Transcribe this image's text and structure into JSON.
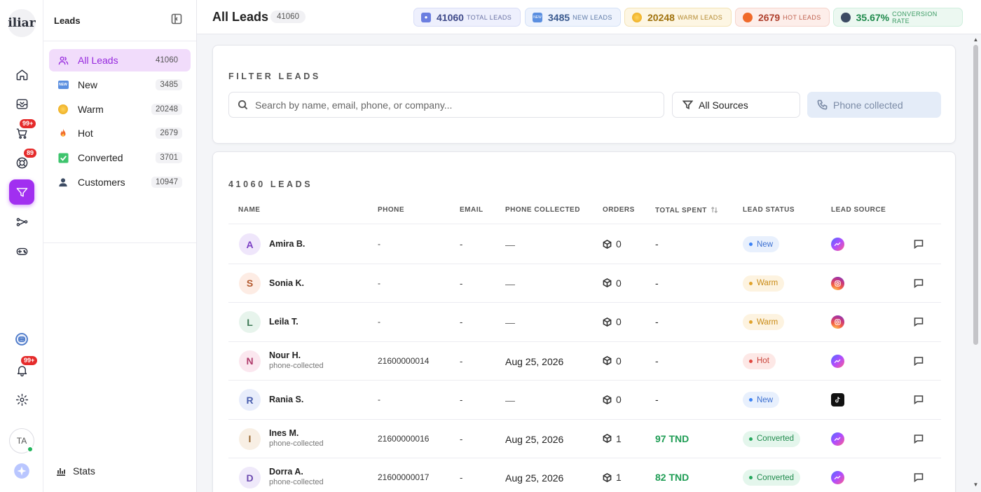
{
  "rail": {
    "logo_text": "iliar",
    "badges": {
      "cart": "99+",
      "support": "89",
      "notifications": "99+"
    },
    "user_initials": "TA",
    "icons": [
      "home-icon",
      "inbox-icon",
      "cart-icon",
      "support-icon",
      "filter-icon",
      "workflow-icon",
      "gamepad-icon",
      "bot-icon",
      "bell-icon",
      "gear-icon",
      "sparkle-icon"
    ]
  },
  "sidebar": {
    "title": "Leads",
    "items": [
      {
        "label": "All Leads",
        "count": "41060",
        "icon": "users-icon"
      },
      {
        "label": "New",
        "count": "3485",
        "icon": "new-icon"
      },
      {
        "label": "Warm",
        "count": "20248",
        "icon": "warm-icon"
      },
      {
        "label": "Hot",
        "count": "2679",
        "icon": "fire-icon"
      },
      {
        "label": "Converted",
        "count": "3701",
        "icon": "check-icon"
      },
      {
        "label": "Customers",
        "count": "10947",
        "icon": "customer-icon"
      }
    ],
    "stats_label": "Stats"
  },
  "header": {
    "title": "All Leads",
    "count": "41060",
    "stats": [
      {
        "value": "41060",
        "label": "TOTAL LEADS"
      },
      {
        "value": "3485",
        "label": "NEW LEADS"
      },
      {
        "value": "20248",
        "label": "WARM LEADS"
      },
      {
        "value": "2679",
        "label": "HOT LEADS"
      },
      {
        "value": "35.67%",
        "label": "CONVERSION RATE"
      }
    ]
  },
  "filter": {
    "title": "FILTER LEADS",
    "search_placeholder": "Search by name, email, phone, or company...",
    "sources_label": "All Sources",
    "phone_label": "Phone collected"
  },
  "table": {
    "title": "41060 LEADS",
    "columns": [
      "NAME",
      "PHONE",
      "EMAIL",
      "PHONE COLLECTED",
      "ORDERS",
      "TOTAL SPENT",
      "LEAD STATUS",
      "LEAD SOURCE"
    ],
    "rows": [
      {
        "initial": "A",
        "name": "Amira B.",
        "sub": "",
        "phone": "-",
        "email": "-",
        "collected": "—",
        "orders": "0",
        "spent": "-",
        "status": "New",
        "source": "messenger"
      },
      {
        "initial": "S",
        "name": "Sonia K.",
        "sub": "",
        "phone": "-",
        "email": "-",
        "collected": "—",
        "orders": "0",
        "spent": "-",
        "status": "Warm",
        "source": "instagram"
      },
      {
        "initial": "L",
        "name": "Leila T.",
        "sub": "",
        "phone": "-",
        "email": "-",
        "collected": "—",
        "orders": "0",
        "spent": "-",
        "status": "Warm",
        "source": "instagram"
      },
      {
        "initial": "N",
        "name": "Nour H.",
        "sub": "phone-collected",
        "phone": "21600000014",
        "email": "-",
        "collected": "Aug 25, 2026",
        "orders": "0",
        "spent": "-",
        "status": "Hot",
        "source": "messenger"
      },
      {
        "initial": "R",
        "name": "Rania S.",
        "sub": "",
        "phone": "-",
        "email": "-",
        "collected": "—",
        "orders": "0",
        "spent": "-",
        "status": "New",
        "source": "tiktok"
      },
      {
        "initial": "I",
        "name": "Ines M.",
        "sub": "phone-collected",
        "phone": "21600000016",
        "email": "-",
        "collected": "Aug 25, 2026",
        "orders": "1",
        "spent": "97 TND",
        "status": "Converted",
        "source": "messenger"
      },
      {
        "initial": "D",
        "name": "Dorra A.",
        "sub": "phone-collected",
        "phone": "21600000017",
        "email": "-",
        "collected": "Aug 25, 2026",
        "orders": "1",
        "spent": "82 TND",
        "status": "Converted",
        "source": "messenger"
      }
    ]
  },
  "colors": {
    "accent": "#a12ff0",
    "status_new": "#3b82f6",
    "status_warm": "#d98b0b",
    "status_hot": "#e0473f",
    "status_converted": "#1f9d55"
  }
}
